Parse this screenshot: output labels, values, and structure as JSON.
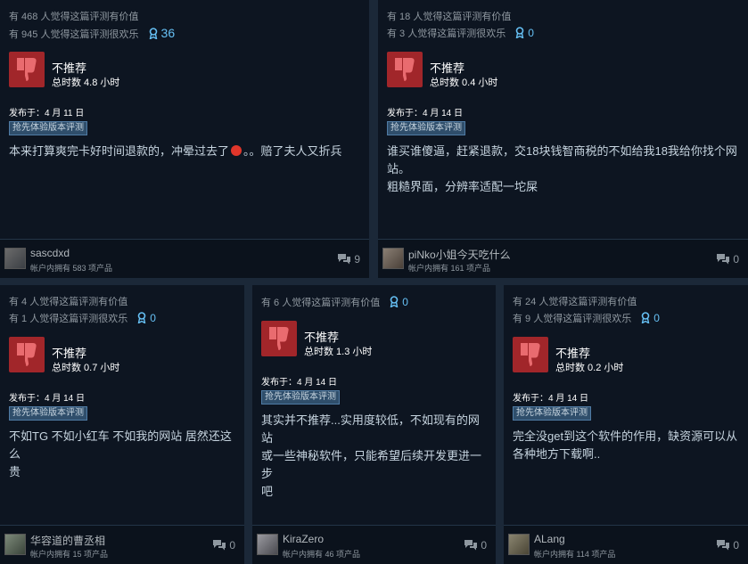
{
  "reviews": [
    {
      "helpful_text": "有 468 人觉得这篇评测有价值",
      "funny_text": "有 945 人觉得这篇评测很欢乐",
      "award_count": "36",
      "verdict": "不推荐",
      "verdict_extra": "",
      "hours": "总时数 4.8 小时",
      "posted": "发布于：4 月 11 日",
      "badge": "抢先体验版本评测",
      "body_parts": [
        "本来打算爽完卡好时间退款的，冲晕过去了",
        "。。赔了夫人又折兵"
      ],
      "username": "sascdxd",
      "products": "帐户内拥有 583 项产品",
      "comments": "9"
    },
    {
      "helpful_text": "有 18 人觉得这篇评测有价值",
      "funny_text": "有 3 人觉得这篇评测很欢乐",
      "award_count": "0",
      "verdict": "不推荐",
      "hours": "总时数 0.4 小时",
      "posted": "发布于：4 月 14 日",
      "badge": "抢先体验版本评测",
      "body_lines": [
        "谁买谁傻逼，赶紧退款，交18块钱智商税的不如给我18我给你找个网",
        "站。",
        "粗糙界面，分辨率适配一坨屎"
      ],
      "username": "piNko小姐今天吃什么",
      "products": "帐户内拥有 161 项产品",
      "comments": "0"
    },
    {
      "helpful_text": "有 4 人觉得这篇评测有价值",
      "funny_text": "有 1 人觉得这篇评测很欢乐",
      "award_count": "0",
      "verdict": "不推荐",
      "hours": "总时数 0.7 小时",
      "posted": "发布于：4 月 14 日",
      "badge": "抢先体验版本评测",
      "body_lines": [
        "不如TG 不如小红车 不如我的网站 居然还这么",
        "贵"
      ],
      "username": "华容道的曹丞相",
      "products": "帐户内拥有 15 项产品",
      "comments": "0"
    },
    {
      "helpful_text": "有 6 人觉得这篇评测有价值",
      "award_count": "0",
      "verdict": "不推荐",
      "hours": "总时数 1.3 小时",
      "posted": "发布于：4 月 14 日",
      "badge": "抢先体验版本评测",
      "body_lines": [
        "其实并不推荐...实用度较低，不如现有的网站",
        "或一些神秘软件，只能希望后续开发更进一步",
        "吧"
      ],
      "username": "KiraZero",
      "products": "帐户内拥有 46 项产品",
      "comments": "0"
    },
    {
      "helpful_text": "有 24 人觉得这篇评测有价值",
      "funny_text": "有 9 人觉得这篇评测很欢乐",
      "award_count": "0",
      "verdict": "不推荐",
      "hours": "总时数 0.2 小时",
      "posted": "发布于：4 月 14 日",
      "badge": "抢先体验版本评测",
      "body_lines": [
        "完全没get到这个软件的作用，缺资源可以从",
        "各种地方下载啊.."
      ],
      "username": "ALang",
      "products": "帐户内拥有 114 项产品",
      "comments": "0"
    }
  ],
  "colors": {
    "background": "#1b2838",
    "card": "#0d1521",
    "thumb_red": "#a1262a",
    "award_blue": "#66c0f4"
  },
  "icons": [
    "thumbs-down-icon",
    "award-ribbon-icon",
    "comment-bubble-icon",
    "avatar"
  ]
}
